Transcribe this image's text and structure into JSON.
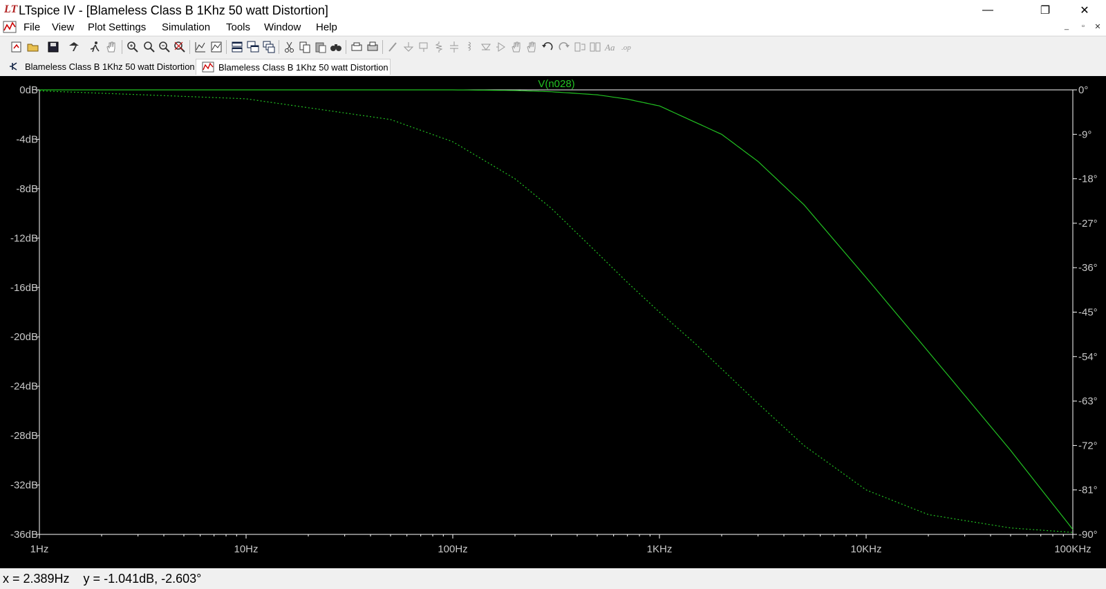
{
  "window": {
    "app_logo": "LT",
    "title": "LTspice IV - [Blameless Class B 1Khz 50 watt Distortion]",
    "controls": {
      "minimize": "—",
      "restore": "❐",
      "close": "✕"
    }
  },
  "menubar": {
    "items": [
      "File",
      "View",
      "Plot Settings",
      "Simulation",
      "Tools",
      "Window",
      "Help"
    ],
    "mdi_controls": {
      "minimize": "_",
      "restore": "▫",
      "close": "✕"
    }
  },
  "toolbar": {
    "icons": [
      "new-schematic-icon",
      "open-icon",
      "save-icon",
      "control-panel-icon",
      "run-icon",
      "pan-hand-icon",
      "zoom-area-icon",
      "zoom-in-icon",
      "zoom-out-icon",
      "zoom-fit-icon",
      "autorange-icon",
      "add-trace-icon",
      "tile-horizontal-icon",
      "cascade-icon",
      "tile-vertical-icon",
      "cut-icon",
      "copy-icon",
      "paste-icon",
      "find-icon",
      "print-preview-icon",
      "print-icon",
      "wire-icon",
      "ground-icon",
      "label-icon",
      "resistor-icon",
      "capacitor-icon",
      "inductor-icon",
      "diode-icon",
      "component-icon",
      "move-icon",
      "drag-icon",
      "undo-icon",
      "redo-icon",
      "rotate-icon",
      "mirror-icon",
      "text-icon",
      "spice-directive-icon"
    ]
  },
  "tabs": [
    {
      "label": "Blameless Class B 1Khz 50 watt Distortion",
      "kind": "schematic",
      "active": false
    },
    {
      "label": "Blameless Class B 1Khz 50 watt Distortion",
      "kind": "waveform",
      "active": true
    }
  ],
  "colors": {
    "trace": "#22c322",
    "axis": "#ffffff",
    "label": "#c8c8c8",
    "background": "#000000"
  },
  "chart_data": {
    "type": "line",
    "title": "V(n028)",
    "x_scale": "log",
    "xlim": [
      1,
      100000
    ],
    "x_tick_labels": [
      "1Hz",
      "10Hz",
      "100Hz",
      "1KHz",
      "10KHz",
      "100KHz"
    ],
    "ylim": [
      -36,
      0
    ],
    "y_tick_labels": [
      "0dB",
      "-4dB",
      "-8dB",
      "-12dB",
      "-16dB",
      "-20dB",
      "-24dB",
      "-28dB",
      "-32dB",
      "-36dB"
    ],
    "y2lim": [
      -90,
      0
    ],
    "y2_tick_labels": [
      "0°",
      "-9°",
      "-18°",
      "-27°",
      "-36°",
      "-45°",
      "-54°",
      "-63°",
      "-72°",
      "-81°",
      "-90°"
    ],
    "grid": false,
    "series": [
      {
        "name": "V(n028)",
        "style": "solid",
        "axis": "magnitude",
        "x": [
          1,
          10,
          100,
          200,
          300,
          500,
          700,
          1000,
          2000,
          3000,
          5000,
          10000,
          20000,
          50000,
          100000
        ],
        "y": [
          0,
          0,
          0,
          -0.05,
          -0.15,
          -0.4,
          -0.75,
          -1.3,
          -3.6,
          -5.8,
          -9.3,
          -15.2,
          -21.2,
          -29.2,
          -35.6
        ]
      },
      {
        "name": "",
        "style": "dotted",
        "axis": "phase",
        "x": [
          1,
          10,
          50,
          100,
          200,
          300,
          500,
          700,
          1000,
          1500,
          2000,
          3000,
          5000,
          10000,
          20000,
          50000,
          100000
        ],
        "y": [
          -0.2,
          -1.8,
          -6,
          -10.5,
          -18,
          -24,
          -33,
          -39,
          -45,
          -51.5,
          -56.5,
          -63.5,
          -72,
          -81,
          -86,
          -88.7,
          -89.6
        ]
      }
    ]
  },
  "statusbar": {
    "cursor": "x = 2.389Hz    y = -1.041dB, -2.603°"
  }
}
